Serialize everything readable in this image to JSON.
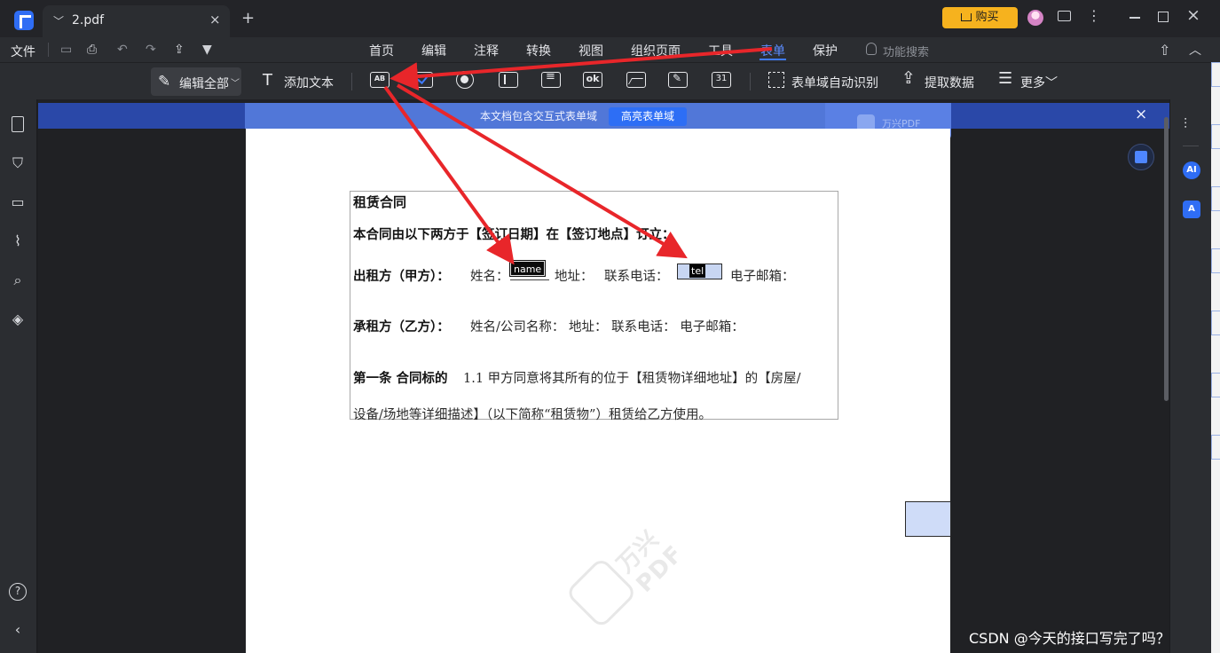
{
  "titlebar": {
    "tab_title": "2.pdf",
    "new_tab": "+",
    "buy_label": "购买",
    "close_glyph": "×",
    "more_glyph": "⋮"
  },
  "menu": {
    "file": "文件",
    "tabs": [
      "首页",
      "编辑",
      "注释",
      "转换",
      "视图",
      "组织页面",
      "工具",
      "表单",
      "保护"
    ],
    "active_tab": "表单",
    "feature_search": "功能搜索"
  },
  "toolbar": {
    "edit_all": "编辑全部",
    "add_text": "添加文本",
    "text_field_icon": "AB",
    "button_icon": "ok",
    "date_icon": "31",
    "auto_detect": "表单域自动识别",
    "extract_data": "提取数据",
    "more": "更多"
  },
  "notice": {
    "text": "本文档包含交互式表单域",
    "highlight_button": "高亮表单域",
    "brand": "万兴PDF"
  },
  "document": {
    "title": "租赁合同",
    "intro": "本合同由以下两方于【签订日期】在【签订地点】订立：",
    "party_a_label": "出租方（甲方）：",
    "party_a_name": "姓名：",
    "name_field_label": "name",
    "party_a_addr": "地址：",
    "party_a_tel": "联系电话：",
    "tel_field_label": "tel",
    "party_a_email": "电子邮箱：",
    "party_b_label": "承租方（乙方）：",
    "party_b_info": "姓名/公司名称：  地址：  联系电话：  电子邮箱：",
    "article1_label": "第一条  合同标的",
    "article1_text": "1.1  甲方同意将其所有的位于【租赁物详细地址】的【房屋/",
    "article1_text2": "设备/场地等详细描述】（以下简称“租赁物”）租赁给乙方使用。",
    "watermark": "万兴PDF"
  },
  "right_panel": {
    "ai": "AI",
    "translate": "A"
  },
  "overlay": {
    "csdn": "CSDN @今天的接口写完了吗？",
    "arrow_color": "#e8262a"
  },
  "colors": {
    "accent": "#2f6df4",
    "buy": "#f6b21e",
    "active_tab": "#5b8cff"
  }
}
